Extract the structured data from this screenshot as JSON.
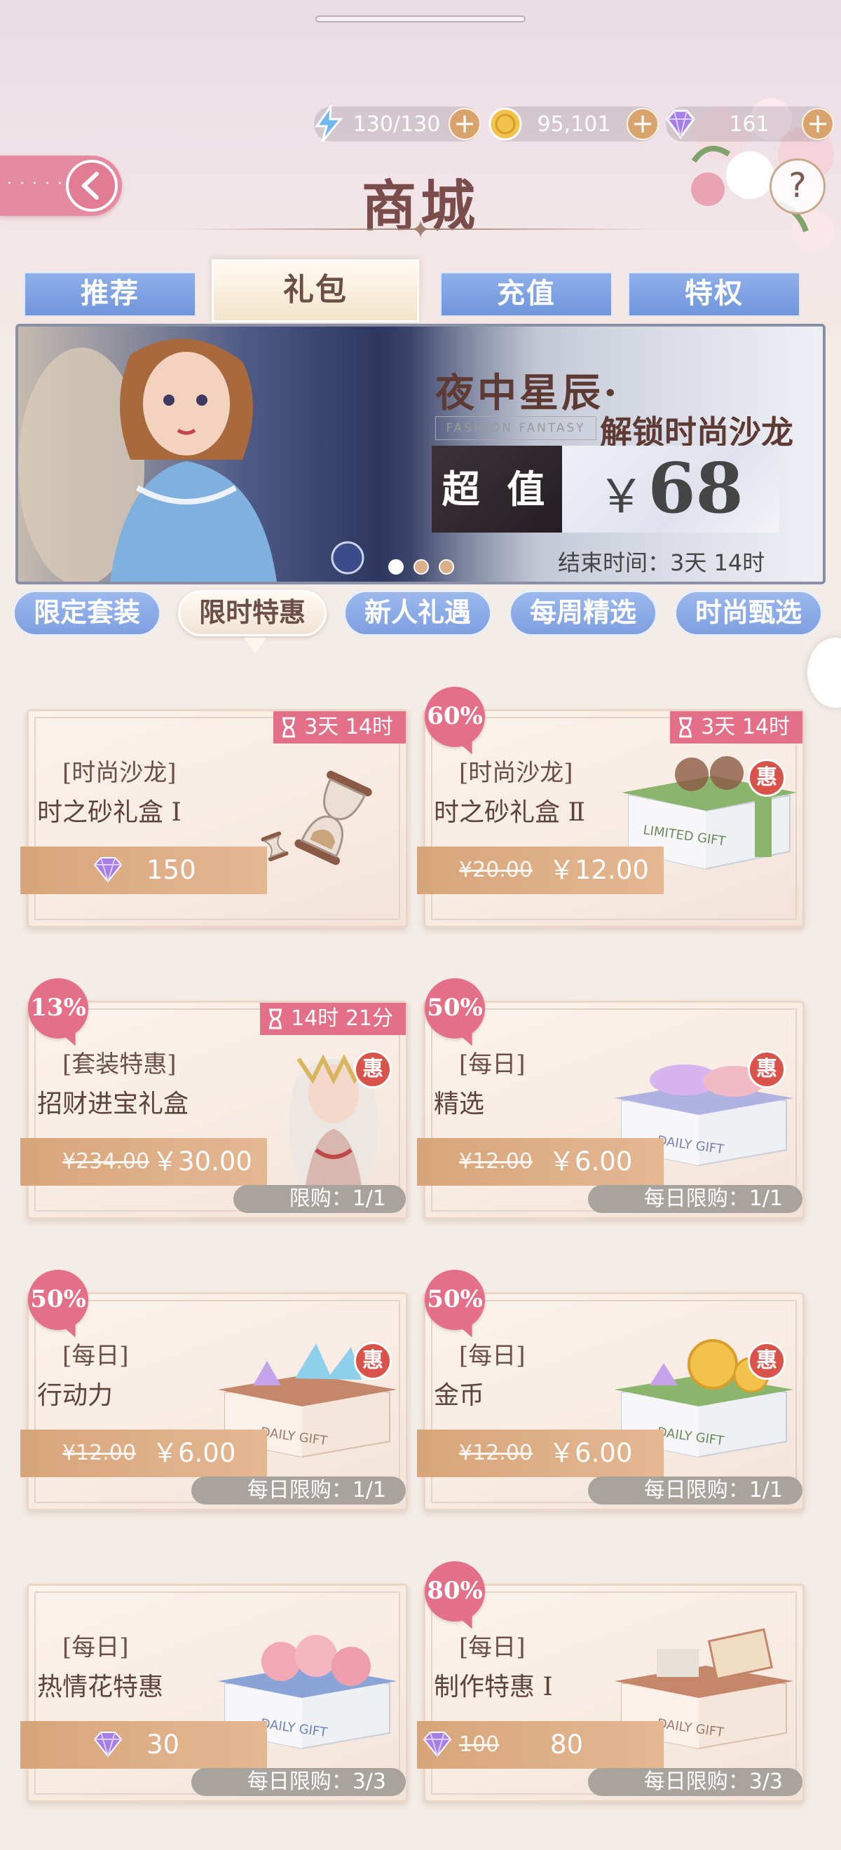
{
  "resources": {
    "stamina": {
      "icon": "lightning-icon",
      "value": "130/130"
    },
    "gold": {
      "icon": "gold-coin-icon",
      "value": "95,101"
    },
    "diamond": {
      "icon": "diamond-icon",
      "value": "161"
    }
  },
  "header": {
    "title": "商城",
    "help_symbol": "?"
  },
  "main_tabs": [
    {
      "label": "推荐"
    },
    {
      "label": "礼包"
    },
    {
      "label": "充值"
    },
    {
      "label": "特权"
    }
  ],
  "active_main_tab": "礼包",
  "banner": {
    "title": "夜中星辰·",
    "en_text": "FASHION FANTASY",
    "subtitle": "解锁时尚沙龙",
    "badge": "超 值",
    "currency": "￥",
    "price": "68",
    "end_time": "结束时间：3天 14时"
  },
  "sub_tabs": [
    {
      "label": "限定套装"
    },
    {
      "label": "限时特惠"
    },
    {
      "label": "新人礼遇"
    },
    {
      "label": "每周精选"
    },
    {
      "label": "时尚甄选"
    }
  ],
  "active_sub_tab": "限时特惠",
  "items": [
    {
      "category": "[时尚沙龙]",
      "name": "时之砂礼盒 Ⅰ",
      "timer": "3天 14时",
      "price_type": "diamond",
      "price": "150"
    },
    {
      "discount": "60%",
      "category": "[时尚沙龙]",
      "name": "时之砂礼盒 Ⅱ",
      "timer": "3天 14时",
      "old_price": "¥20.00",
      "new_price": "￥12.00",
      "hui": "惠",
      "box_text": "LIMITED GIFT"
    },
    {
      "discount": "13%",
      "category": "[套装特惠]",
      "name": "招财进宝礼盒",
      "timer": "14时 21分",
      "old_price": "¥234.00",
      "new_price": "￥30.00",
      "hui": "惠",
      "limit": "限购：1/1"
    },
    {
      "discount": "50%",
      "category": "[每日]",
      "name": "精选",
      "old_price": "¥12.00",
      "new_price": "￥6.00",
      "hui": "惠",
      "limit": "每日限购：1/1",
      "box_text": "DAILY GIFT"
    },
    {
      "discount": "50%",
      "category": "[每日]",
      "name": "行动力",
      "old_price": "¥12.00",
      "new_price": "￥6.00",
      "hui": "惠",
      "limit": "每日限购：1/1",
      "box_text": "DAILY GIFT"
    },
    {
      "discount": "50%",
      "category": "[每日]",
      "name": "金币",
      "old_price": "¥12.00",
      "new_price": "￥6.00",
      "hui": "惠",
      "limit": "每日限购：1/1",
      "box_text": "DAILY GIFT"
    },
    {
      "category": "[每日]",
      "name": "热情花特惠",
      "price_type": "diamond",
      "price": "30",
      "limit": "每日限购：3/3",
      "box_text": "DAILY GIFT"
    },
    {
      "discount": "80%",
      "category": "[每日]",
      "name": "制作特惠 Ⅰ",
      "price_type": "diamond",
      "old_price": "100",
      "price": "80",
      "limit": "每日限购：3/3",
      "box_text": "DAILY GIFT"
    }
  ],
  "colors": {
    "accent_pink": "#e36f88",
    "tab_blue": "#7e9fe0",
    "price_tan": "#d8a57a"
  }
}
